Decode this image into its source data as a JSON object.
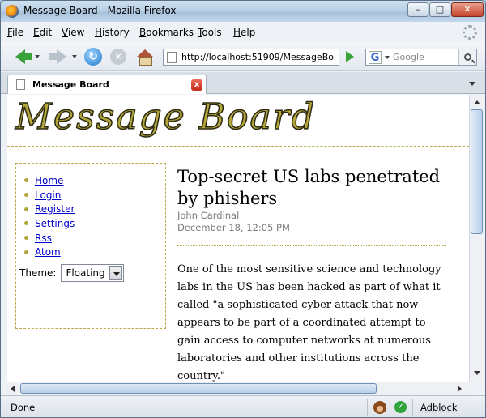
{
  "window": {
    "title": "Message Board - Mozilla Firefox"
  },
  "menubar": {
    "items": [
      {
        "label": "File",
        "key": "F",
        "rest": "ile"
      },
      {
        "label": "Edit",
        "key": "E",
        "rest": "dit"
      },
      {
        "label": "View",
        "key": "V",
        "rest": "iew"
      },
      {
        "label": "History",
        "key": "H",
        "rest": "istory"
      },
      {
        "label": "Bookmarks",
        "key": "B",
        "rest": "ookmarks"
      },
      {
        "label": "Tools",
        "key": "T",
        "rest": "ools"
      },
      {
        "label": "Help",
        "key": "H",
        "rest": "elp"
      }
    ]
  },
  "navbar": {
    "url": "http://localhost:51909/MessageBo",
    "search_placeholder": "Google",
    "search_engine_letter": "G"
  },
  "tab": {
    "label": "Message Board",
    "close": "x"
  },
  "page": {
    "logo": "Message Board",
    "nav": [
      {
        "label": "Home"
      },
      {
        "label": "Login"
      },
      {
        "label": "Register"
      },
      {
        "label": "Settings"
      },
      {
        "label": "Rss"
      },
      {
        "label": "Atom"
      }
    ],
    "theme_label": "Theme:",
    "theme_value": "Floating",
    "article": {
      "title": "Top-secret US labs penetrated by phishers",
      "author": "John Cardinal",
      "date": "December 18, 12:05 PM",
      "body": "One of the most sensitive science and technology labs in the US has been hacked as part of what it called \"a sophisticated cyber attack that now appears to be part of a coordinated attempt to gain access to computer networks at numerous laboratories and other institutions across the country.\""
    }
  },
  "statusbar": {
    "text": "Done",
    "adblock": "Adblock"
  },
  "colors": {
    "accent": "#b3a63a",
    "link": "#0000cc",
    "muted": "#7a7a7a"
  }
}
